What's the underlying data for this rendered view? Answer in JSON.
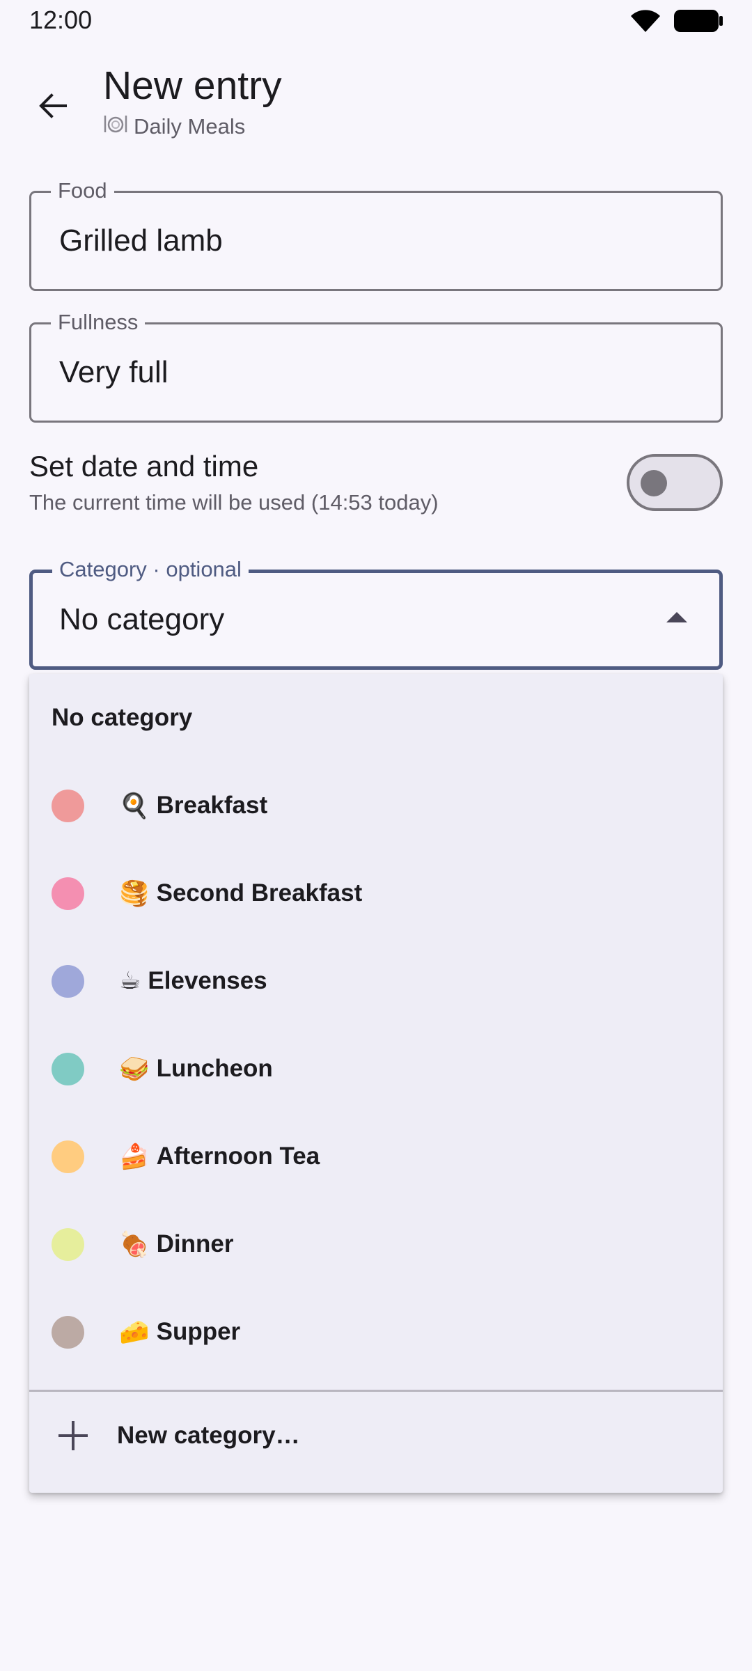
{
  "status_bar": {
    "time": "12:00",
    "icons": [
      "wifi-icon",
      "battery-icon"
    ]
  },
  "header": {
    "title": "New entry",
    "subtitle_icon": "plate-icon",
    "subtitle": "Daily Meals"
  },
  "form": {
    "food": {
      "label": "Food",
      "value": "Grilled lamb"
    },
    "fullness": {
      "label": "Fullness",
      "value": "Very full"
    },
    "date_time": {
      "title": "Set date and time",
      "subtitle": "The current time will be used (14:53 today)",
      "enabled": false
    },
    "category": {
      "label": "Category · optional",
      "value": "No category"
    }
  },
  "menu": {
    "none_label": "No category",
    "items": [
      {
        "emoji": "🍳",
        "label": "Breakfast",
        "color": "#ef9a9a"
      },
      {
        "emoji": "🥞",
        "label": "Second Breakfast",
        "color": "#f48fb1"
      },
      {
        "emoji": "☕",
        "label": "Elevenses",
        "color": "#9fa8da"
      },
      {
        "emoji": "🥪",
        "label": "Luncheon",
        "color": "#80cbc4"
      },
      {
        "emoji": "🍰",
        "label": "Afternoon Tea",
        "color": "#ffcc80"
      },
      {
        "emoji": "🍖",
        "label": "Dinner",
        "color": "#e6ee9c"
      },
      {
        "emoji": "🧀",
        "label": "Supper",
        "color": "#bcaaa4"
      }
    ],
    "new_category_label": "New category…"
  }
}
